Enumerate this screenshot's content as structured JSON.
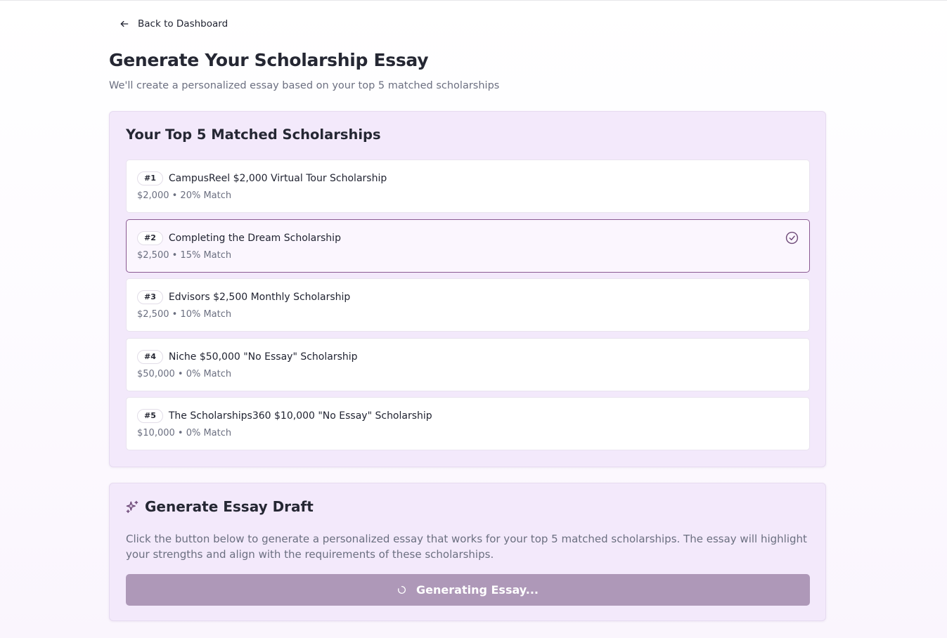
{
  "nav": {
    "back_label": "Back to Dashboard",
    "back_icon": "arrow-left-icon"
  },
  "header": {
    "title": "Generate Your Scholarship Essay",
    "subtitle": "We'll create a personalized essay based on your top 5 matched scholarships"
  },
  "matches": {
    "title": "Your Top 5 Matched Scholarships",
    "items": [
      {
        "rank": "#1",
        "name": "CampusReel $2,000 Virtual Tour Scholarship",
        "amount": "$2,000",
        "match": "20% Match",
        "meta": "$2,000 • 20% Match",
        "selected": false
      },
      {
        "rank": "#2",
        "name": "Completing the Dream Scholarship",
        "amount": "$2,500",
        "match": "15% Match",
        "meta": "$2,500 • 15% Match",
        "selected": true
      },
      {
        "rank": "#3",
        "name": "Edvisors $2,500 Monthly Scholarship",
        "amount": "$2,500",
        "match": "10% Match",
        "meta": "$2,500 • 10% Match",
        "selected": false
      },
      {
        "rank": "#4",
        "name": "Niche $50,000 \"No Essay\" Scholarship",
        "amount": "$50,000",
        "match": "0% Match",
        "meta": "$50,000 • 0% Match",
        "selected": false
      },
      {
        "rank": "#5",
        "name": "The Scholarships360 $10,000 \"No Essay\" Scholarship",
        "amount": "$10,000",
        "match": "0% Match",
        "meta": "$10,000 • 0% Match",
        "selected": false
      }
    ],
    "selected_icon": "check-circle-icon"
  },
  "generate": {
    "title": "Generate Essay Draft",
    "title_icon": "sparkles-icon",
    "description": "Click the button below to generate a personalized essay that works for your top 5 matched scholarships. The essay will highlight your strengths and align with the requirements of these scholarships.",
    "button_label": "Generating Essay...",
    "button_icon": "loading-spinner-icon",
    "button_state": "loading"
  },
  "colors": {
    "accent": "#8a5a92",
    "panel_bg": "#f3e9fb",
    "button_bg": "#ae98b8",
    "text_primary": "#252733",
    "text_muted": "#6b6f80"
  }
}
